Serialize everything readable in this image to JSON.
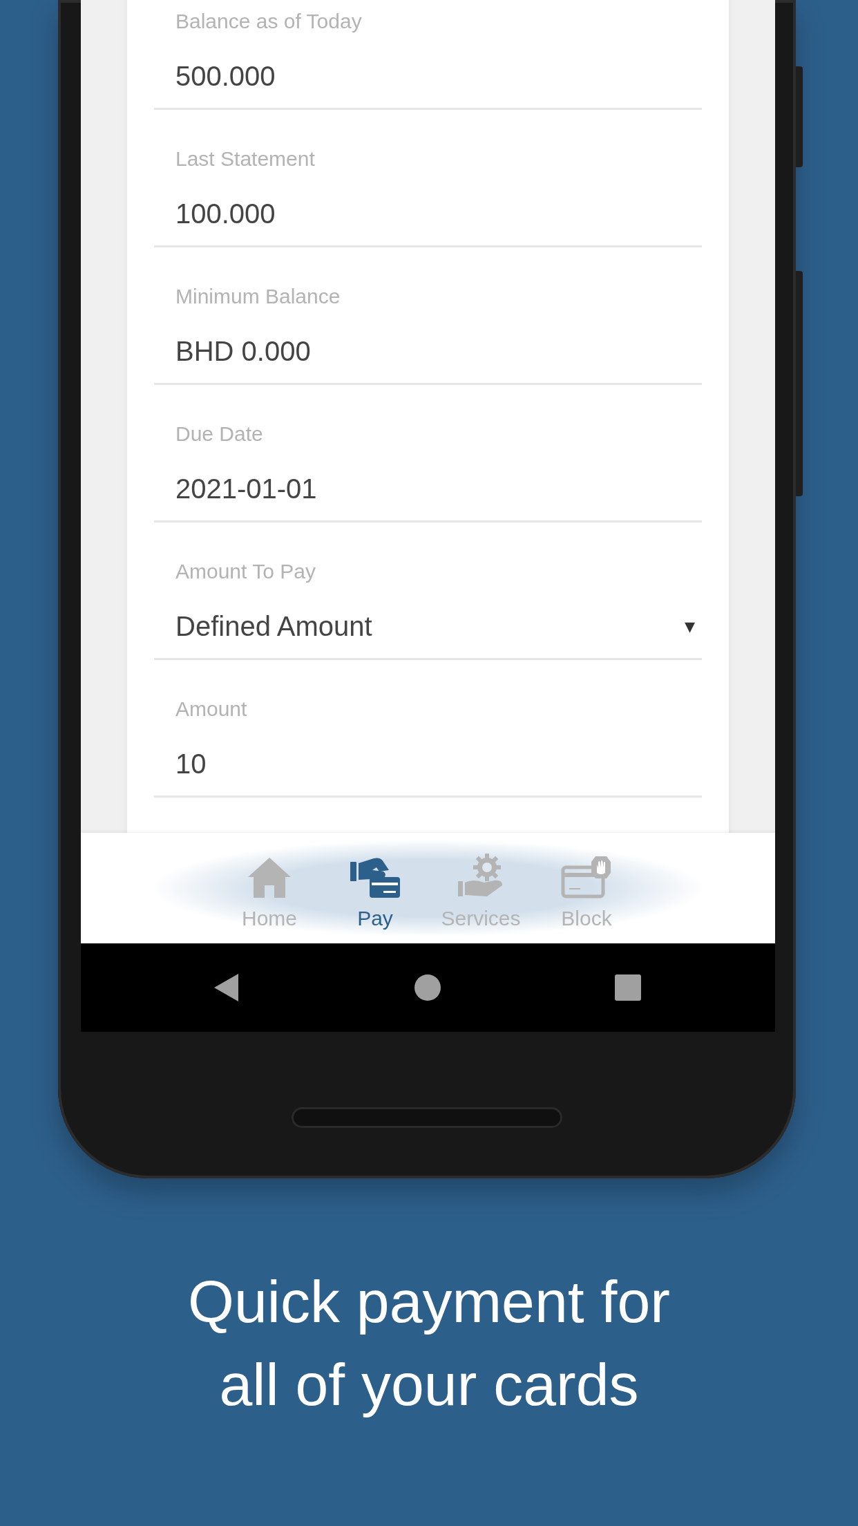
{
  "fields": [
    {
      "label": "Balance as of Today",
      "value": "500.000",
      "kind": "text"
    },
    {
      "label": "Last Statement",
      "value": "100.000",
      "kind": "text"
    },
    {
      "label": "Minimum Balance",
      "value": "BHD 0.000",
      "kind": "text"
    },
    {
      "label": "Due Date",
      "value": "2021-01-01",
      "kind": "text"
    },
    {
      "label": "Amount To Pay",
      "value": "Defined Amount",
      "kind": "dropdown",
      "caret": "▾"
    },
    {
      "label": "Amount",
      "value": "10",
      "kind": "text"
    }
  ],
  "bottom_nav": [
    {
      "label": "Home",
      "selected": false
    },
    {
      "label": "Pay",
      "selected": true
    },
    {
      "label": "Services",
      "selected": false
    },
    {
      "label": "Block",
      "selected": false
    }
  ],
  "caption": "Quick payment for all of your cards"
}
